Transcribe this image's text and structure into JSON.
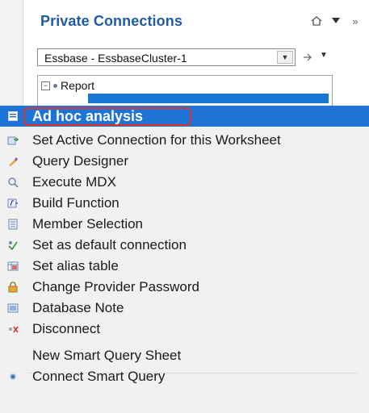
{
  "panel": {
    "title": "Private Connections",
    "connection": "Essbase - EssbaseCluster-1",
    "tree": {
      "root_label": "Report"
    }
  },
  "menu": {
    "items": [
      {
        "label": "Ad hoc analysis",
        "icon": "adhoc-icon"
      },
      {
        "label": "Set Active Connection for this Worksheet",
        "icon": "set-active-icon"
      },
      {
        "label": "Query Designer",
        "icon": "query-designer-icon"
      },
      {
        "label": "Execute MDX",
        "icon": "execute-mdx-icon"
      },
      {
        "label": "Build Function",
        "icon": "build-function-icon"
      },
      {
        "label": "Member Selection",
        "icon": "member-selection-icon"
      },
      {
        "label": "Set as default connection",
        "icon": "default-connection-icon"
      },
      {
        "label": "Set alias table",
        "icon": "alias-table-icon"
      },
      {
        "label": "Change Provider Password",
        "icon": "lock-icon"
      },
      {
        "label": "Database Note",
        "icon": "database-note-icon"
      },
      {
        "label": "Disconnect",
        "icon": "disconnect-icon"
      },
      {
        "label": "New Smart Query Sheet",
        "icon": ""
      },
      {
        "label": "Connect Smart Query",
        "icon": "connect-smart-query-icon"
      }
    ]
  },
  "colors": {
    "title": "#1f5ba5",
    "highlight": "#1e74d6",
    "highlight_ring": "#e0312c",
    "menu_bg": "#f1f1f1"
  }
}
